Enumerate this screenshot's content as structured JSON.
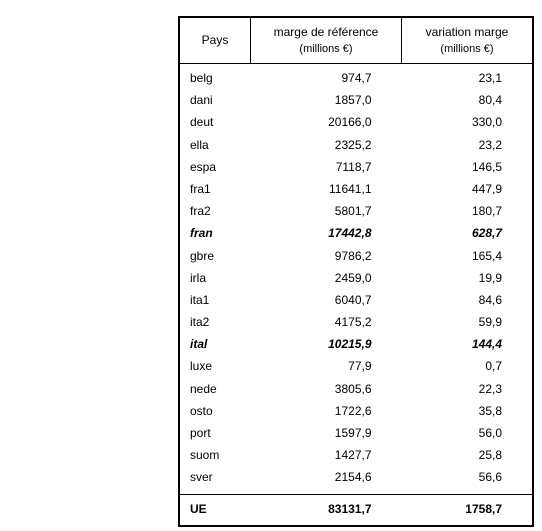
{
  "chart_data": {
    "type": "table",
    "columns": [
      "Pays",
      "marge de référence (millions €)",
      "variation marge (millions €)"
    ],
    "rows": [
      [
        "belg",
        974.7,
        23.1
      ],
      [
        "dani",
        1857.0,
        80.4
      ],
      [
        "deut",
        20166.0,
        330.0
      ],
      [
        "ella",
        2325.2,
        23.2
      ],
      [
        "espa",
        7118.7,
        146.5
      ],
      [
        "fra1",
        11641.1,
        447.9
      ],
      [
        "fra2",
        5801.7,
        180.7
      ],
      [
        "fran",
        17442.8,
        628.7
      ],
      [
        "gbre",
        9786.2,
        165.4
      ],
      [
        "irla",
        2459.0,
        19.9
      ],
      [
        "ita1",
        6040.7,
        84.6
      ],
      [
        "ita2",
        4175.2,
        59.9
      ],
      [
        "ital",
        10215.9,
        144.4
      ],
      [
        "luxe",
        77.9,
        0.7
      ],
      [
        "nede",
        3805.6,
        22.3
      ],
      [
        "osto",
        1722.6,
        35.8
      ],
      [
        "port",
        1597.9,
        56.0
      ],
      [
        "suom",
        1427.7,
        25.8
      ],
      [
        "sver",
        2154.6,
        56.6
      ],
      [
        "UE",
        83131.7,
        1758.7
      ]
    ]
  },
  "headers": {
    "pays": "Pays",
    "ref_l1": "marge de référence",
    "ref_l2": "(millions €)",
    "var_l1": "variation marge",
    "var_l2": "(millions €)"
  },
  "rows": [
    {
      "pays": "belg",
      "ref": "974,7",
      "var": "23,1",
      "emph": false
    },
    {
      "pays": "dani",
      "ref": "1857,0",
      "var": "80,4",
      "emph": false
    },
    {
      "pays": "deut",
      "ref": "20166,0",
      "var": "330,0",
      "emph": false
    },
    {
      "pays": "ella",
      "ref": "2325,2",
      "var": "23,2",
      "emph": false
    },
    {
      "pays": "espa",
      "ref": "7118,7",
      "var": "146,5",
      "emph": false
    },
    {
      "pays": "fra1",
      "ref": "11641,1",
      "var": "447,9",
      "emph": false
    },
    {
      "pays": "fra2",
      "ref": "5801,7",
      "var": "180,7",
      "emph": false
    },
    {
      "pays": "fran",
      "ref": "17442,8",
      "var": "628,7",
      "emph": true
    },
    {
      "pays": "gbre",
      "ref": "9786,2",
      "var": "165,4",
      "emph": false
    },
    {
      "pays": "irla",
      "ref": "2459,0",
      "var": "19,9",
      "emph": false
    },
    {
      "pays": "ita1",
      "ref": "6040,7",
      "var": "84,6",
      "emph": false
    },
    {
      "pays": "ita2",
      "ref": "4175,2",
      "var": "59,9",
      "emph": false
    },
    {
      "pays": "ital",
      "ref": "10215,9",
      "var": "144,4",
      "emph": true
    },
    {
      "pays": "luxe",
      "ref": "77,9",
      "var": "0,7",
      "emph": false
    },
    {
      "pays": "nede",
      "ref": "3805,6",
      "var": "22,3",
      "emph": false
    },
    {
      "pays": "osto",
      "ref": "1722,6",
      "var": "35,8",
      "emph": false
    },
    {
      "pays": "port",
      "ref": "1597,9",
      "var": "56,0",
      "emph": false
    },
    {
      "pays": "suom",
      "ref": "1427,7",
      "var": "25,8",
      "emph": false
    },
    {
      "pays": "sver",
      "ref": "2154,6",
      "var": "56,6",
      "emph": false
    }
  ],
  "total": {
    "pays": "UE",
    "ref": "83131,7",
    "var": "1758,7"
  }
}
